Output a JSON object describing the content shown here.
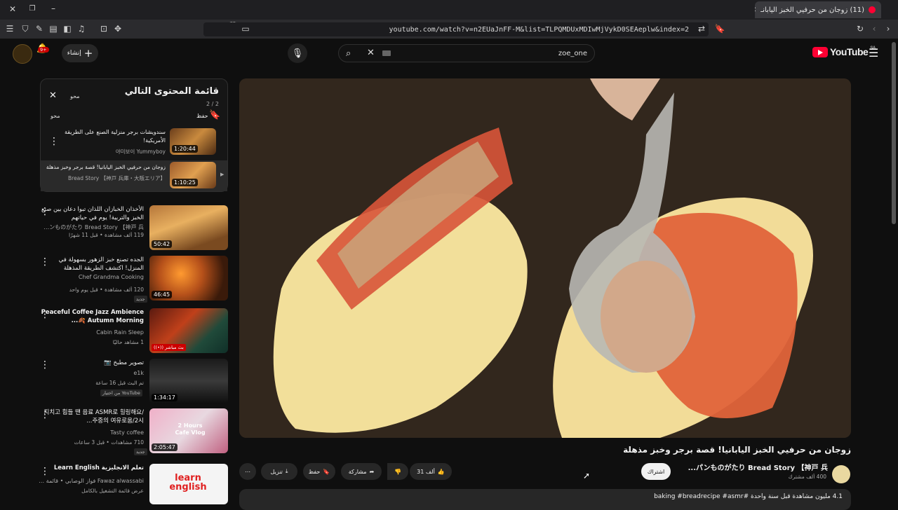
{
  "browser": {
    "tab_title": "(11) زوجان من حرفيي الخبز اليابانـ",
    "url": "youtube.com/watch?v=n2EUaJnFF-M&list=TLPQMDUxMDIwMjVykD0SEAeplw&index=2",
    "shield_count": "10"
  },
  "header": {
    "logo_text": "YouTube",
    "logo_region": "SA",
    "search_value": "zoe_one",
    "create_label": "إنشاء",
    "notif_count": "9+"
  },
  "playlist": {
    "title": "قائمة المحتوى التالي",
    "count": "2 / 2",
    "clear_label": "محو",
    "save_label": "حفظ",
    "clear_label2": "محو",
    "items": [
      {
        "title": "سندويشات برجر منزلية الصنع على الطريقة الأمريكية!",
        "channel": "야미보이 Yummyboy",
        "duration": "1:20:44"
      },
      {
        "title": "زوجان من حرفيي الخبز اليابانيا! قصة برجر وخبز مذهلة",
        "channel": "Bread Story 【神戸 兵庫・大阪エリア】",
        "duration": "1:10:25"
      }
    ]
  },
  "recommendations": [
    {
      "title": "الأخذان الخبازان اللذان تبوا دعان بين صنع الخبز والتربية! يوم في حياتهم",
      "channel": "パンものがたり Bread Story 【神戸 兵...",
      "meta": "119 ألف مشاهدة • قبل 11 شهرًا",
      "duration": "50:42",
      "badge": ""
    },
    {
      "title": "الجده تصنع خبز الزهور بسهولة في المنزل! اكتشف الطريقة المذهلة",
      "channel": "Chef Grandma Cooking",
      "meta": "120 ألف مشاهدة • قبل يوم واحد",
      "duration": "46:45",
      "badge": "جديد"
    },
    {
      "title": "Peaceful Coffee Jazz Ambience 🍂 Autumn Morning...",
      "channel": "Cabin Rain Sleep",
      "meta": "1 مشاهد حاليًا",
      "duration": "",
      "badge": "((•)) بث مباشر"
    },
    {
      "title": "تصوير مطبخ 📷",
      "channel": "e1k",
      "meta": "تم البث قبل 16 ساعة",
      "duration": "1:34:17",
      "badge": "من اختيار YouTube"
    },
    {
      "title": "지치고 힘들 땐 음료 ASMR로 힐링해요/주중의 여유로움/2시...",
      "channel": "Tasty coffee",
      "meta": "710 مشاهدات • قبل 3 ساعات",
      "duration": "2:05:47",
      "badge": "جديد"
    },
    {
      "title": "تعلم الانجليزية Learn English",
      "channel": "Fawaz alwassabi فواز الوصابي • قائمة تشغيل",
      "meta": "عرض قائمة التشغيل بالكامل",
      "duration": "",
      "badge": ""
    }
  ],
  "rec_thumb_texts": {
    "cafe_vlog": "2 Hours Cafe Vlog",
    "learn_english": "learn english"
  },
  "video": {
    "title": "زوجان من حرفيي الخبز اليابانيا! قصة برجر وخبز مذهلة",
    "channel": "パンものがたり Bread Story 【神戸 兵...",
    "subscribers": "400 ألف مشترك",
    "subscribe_label": "اشتراك",
    "likes": "31 ألف",
    "share_label": "مشاركة",
    "save_label": "حفظ",
    "download_label": "تنزيل",
    "description": "4.1 مليون مشاهدة قبل سنة واحدة  #baking #breadrecipe #asmr"
  },
  "colors": {
    "accent": "#ff0033",
    "bg": "#0f0f0f",
    "chip": "#272727"
  }
}
